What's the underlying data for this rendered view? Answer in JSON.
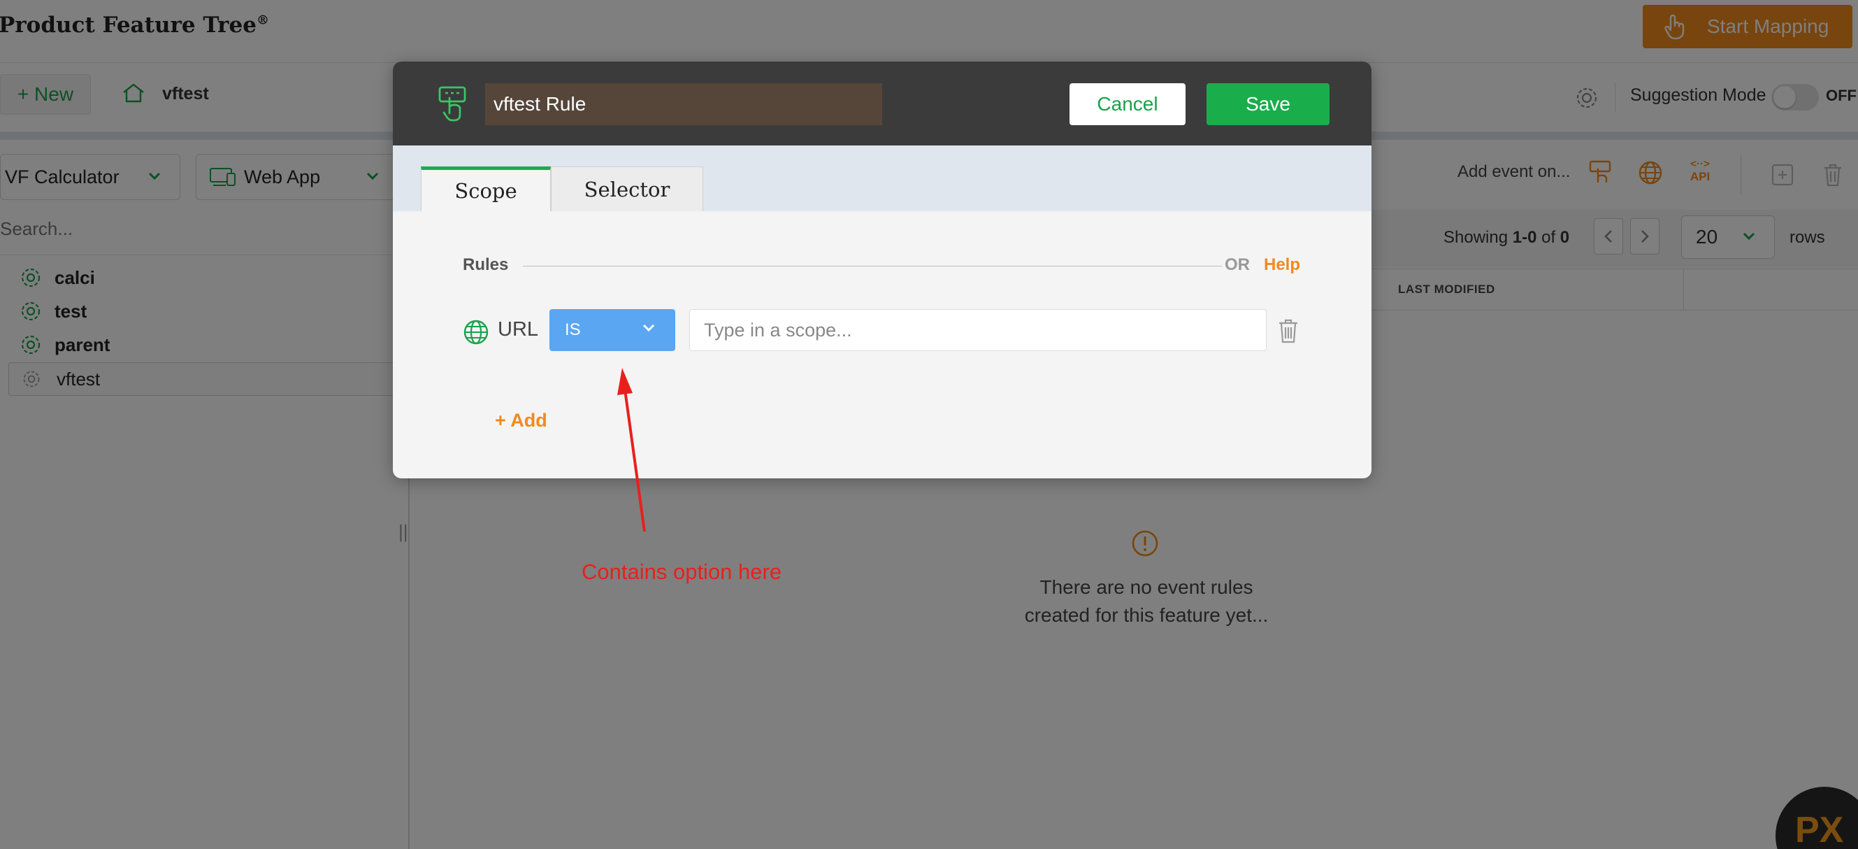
{
  "app": {
    "title": "Product Feature Tree",
    "reg": "®",
    "start_mapping": "Start Mapping"
  },
  "subbar": {
    "new_label": "+ New",
    "breadcrumb": "vftest",
    "suggestion_mode": "Suggestion Mode",
    "toggle_state": "OFF"
  },
  "sidebar": {
    "app_select": "VF Calculator",
    "platform_select": "Web App",
    "search_placeholder": "Search...",
    "items": [
      {
        "label": "calci"
      },
      {
        "label": "test"
      },
      {
        "label": "parent"
      }
    ],
    "selected_item": "vftest"
  },
  "content": {
    "add_event_label": "Add event on...",
    "api_label": "API",
    "showing_prefix": "Showing ",
    "showing_range": "1-0",
    "showing_suffix": " of ",
    "showing_total": "0",
    "rows_value": "20",
    "rows_label": "rows",
    "column_last_modified": "LAST MODIFIED",
    "empty_message_line1": "There are no event rules",
    "empty_message_line2": "created for this feature yet..."
  },
  "badge": {
    "text": "PX"
  },
  "modal": {
    "rule_name": "vftest Rule",
    "cancel_label": "Cancel",
    "save_label": "Save",
    "tabs": [
      {
        "label": "Scope"
      },
      {
        "label": "Selector"
      }
    ],
    "rules_label": "Rules",
    "or_label": "OR",
    "help_label": "Help",
    "rule": {
      "field": "URL",
      "operator": "IS",
      "input_placeholder": "Type in a scope..."
    },
    "add_label": "+ Add"
  },
  "annotation": {
    "text": "Contains option here"
  },
  "colors": {
    "brand_orange": "#f08a1d",
    "brand_green": "#1aad4b",
    "operator_blue": "#5aa6f2",
    "annotation_red": "#e8201c"
  }
}
